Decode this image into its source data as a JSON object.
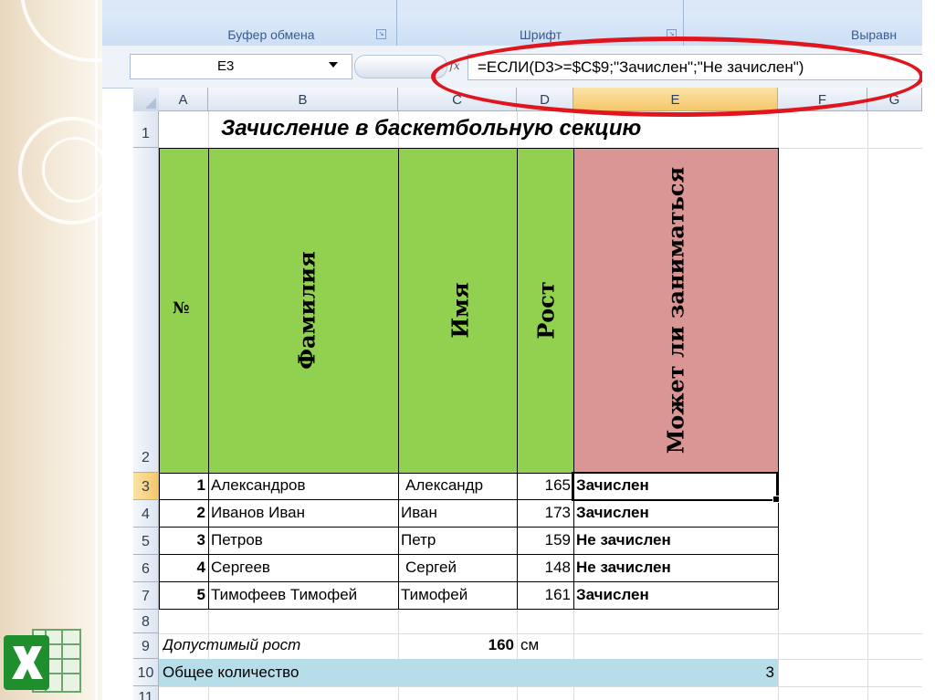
{
  "ribbon": {
    "groups": [
      "Буфер обмена",
      "Шрифт",
      "Выравн"
    ]
  },
  "formula_bar": {
    "name_box": "E3",
    "fx": "fx",
    "formula": "=ЕСЛИ(D3>=$C$9;\"Зачислен\";\"Не зачислен\")"
  },
  "columns": [
    "A",
    "B",
    "C",
    "D",
    "E",
    "F",
    "G"
  ],
  "rows": [
    "1",
    "2",
    "3",
    "4",
    "5",
    "6",
    "7",
    "8",
    "9",
    "10",
    "11"
  ],
  "selected_cell": "E3",
  "sheet": {
    "title": "Зачисление в баскетбольную секцию",
    "headers": {
      "num": "№",
      "surname": "Фамилия",
      "name": "Имя",
      "height": "Рост",
      "allowed": "Может ли заниматься"
    },
    "students": [
      {
        "n": "1",
        "surname": "Александров",
        "name": "Александр",
        "height": "165",
        "status": "Зачислен"
      },
      {
        "n": "2",
        "surname": "Иванов Иван",
        "name": "Иван",
        "height": "173",
        "status": "Зачислен"
      },
      {
        "n": "3",
        "surname": "Петров",
        "name": "Петр",
        "height": "159",
        "status": "Не зачислен"
      },
      {
        "n": "4",
        "surname": "Сергеев",
        "name": "Сергей",
        "height": "148",
        "status": "Не зачислен"
      },
      {
        "n": "5",
        "surname": "Тимофеев Тимофей",
        "name": "Тимофей",
        "height": "161",
        "status": "Зачислен"
      }
    ],
    "allowed_height_label": "Допустимый рост",
    "allowed_height_value": "160",
    "allowed_height_unit": "см",
    "total_label": "Общее количество",
    "total_value": "3"
  },
  "colors": {
    "header_green": "#92d050",
    "header_pink": "#da9694",
    "total_row": "#b7dde8",
    "annotation_circle": "#e0161e"
  }
}
